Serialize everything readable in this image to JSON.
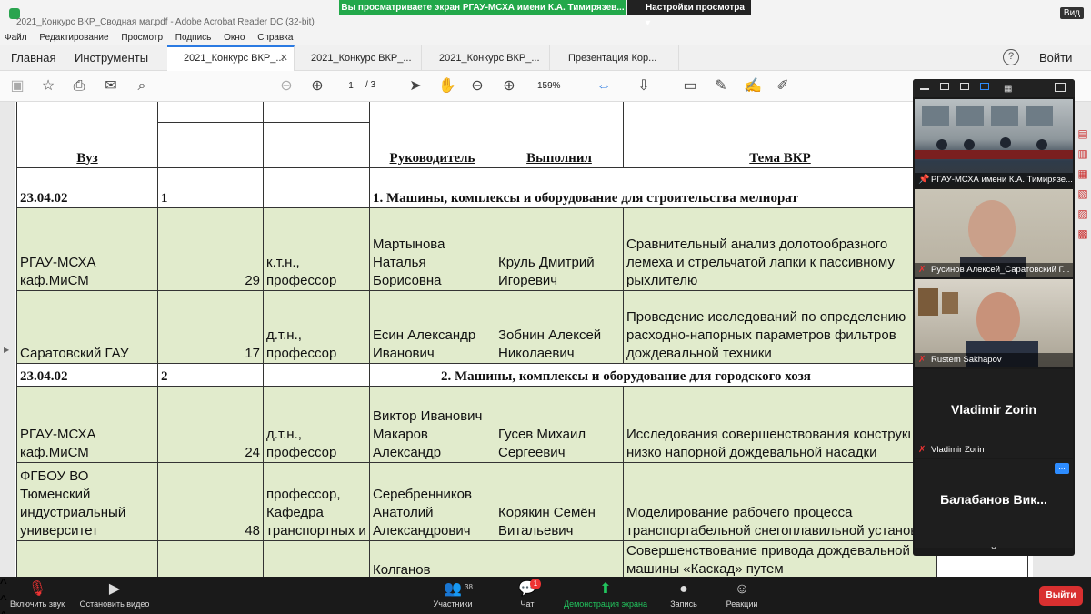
{
  "window": {
    "doc_title": "2021_Конкурс ВКР_Сводная маг.pdf - Adobe Acrobat Reader DC (32-bit)",
    "view_label": "Вид"
  },
  "share_banner": {
    "text": "Вы просматриваете экран РГАУ-МСХА имени К.А. Тимирязев...",
    "settings_label": "Настройки просмотра ▾"
  },
  "menubar": [
    "Файл",
    "Редактирование",
    "Просмотр",
    "Подпись",
    "Окно",
    "Справка"
  ],
  "tabs": {
    "home": "Главная",
    "tools": "Инструменты",
    "docs": [
      {
        "label": "2021_Конкурс ВКР_...",
        "active": true
      },
      {
        "label": "2021_Конкурс ВКР_...",
        "active": false
      },
      {
        "label": "2021_Конкурс ВКР_...",
        "active": false
      },
      {
        "label": "Презентация  Кор...",
        "active": false
      }
    ],
    "help": "?",
    "login": "Войти"
  },
  "toolbar": {
    "page_current": "1",
    "page_total": "/ 3",
    "zoom": "159%"
  },
  "table": {
    "headers": {
      "vuz": "Вуз",
      "leader": "Руководитель",
      "performer": "Выполнил",
      "topic": "Тема ВКР"
    },
    "sections": [
      {
        "code": "23.04.02",
        "num": "1",
        "title": "1. Машины, комплексы и оборудование для строительства мелиорат",
        "rows": [
          {
            "vuz": "РГАУ-МСХА каф.МиСМ",
            "score": "29",
            "degree": "к.т.н., профессор",
            "leader": "Мартынова Наталья Борисовна",
            "performer": "Круль Дмитрий Игоревич",
            "topic": "Сравнительный анализ долотообразного лемеха и стрельчатой лапки к пассивному рыхлителю"
          },
          {
            "vuz": "Саратовский ГАУ",
            "score": "17",
            "degree": "д.т.н., профессор",
            "leader": "Есин Александр Иванович",
            "performer": "Зобнин Алексей Николаевич",
            "topic": "Проведение исследований по определению расходно-напорных параметров фильтров дождевальной техники"
          }
        ]
      },
      {
        "code": "23.04.02",
        "num": "2",
        "title": "2. Машины, комплексы и оборудование для городского хозя",
        "rows": [
          {
            "vuz": "РГАУ-МСХА каф.МиСМ",
            "score": "24",
            "degree": "д.т.н., профессор",
            "leader": "Виктор Иванович Макаров Александр",
            "performer": "Гусев Михаил Сергеевич",
            "topic": "Исследования совершенствования конструкции  низко напорной дождевальной  насадки"
          },
          {
            "vuz": "ФГБОУ ВО Тюменский индустриальный университет",
            "score": "48",
            "degree": "профессор, Кафедра транспортных и",
            "leader": "Серебренников Анатолий Александрович",
            "performer": "Корякин Семён Витальевич",
            "topic": "Моделирование рабочего процесса транспортабельной снегоплавильной установки"
          },
          {
            "vuz": "",
            "score": "",
            "degree": "",
            "leader": "Колганов",
            "performer": "",
            "topic": "Совершенствование привода дождевальной машины «Каскад» путем"
          }
        ]
      }
    ]
  },
  "video_panel": {
    "tiles": [
      {
        "name": "РГАУ-МСХА имени К.А. Тимирязе...",
        "kind": "room"
      },
      {
        "name": "Русинов Алексей_Саратовский Г...",
        "kind": "person"
      },
      {
        "name": "Rustem Sakhapov",
        "kind": "person"
      },
      {
        "name": "Vladimir Zorin",
        "big": "Vladimir Zorin",
        "kind": "avatar"
      },
      {
        "name": "",
        "big": "Балабанов  Вик...",
        "kind": "avatar"
      }
    ],
    "more": "..."
  },
  "zoom_bar": {
    "mute": "Включить звук",
    "video": "Остановить видео",
    "participants": "Участники",
    "participants_count": "38",
    "chat": "Чат",
    "chat_badge": "1",
    "share": "Демонстрация экрана",
    "record": "Запись",
    "reactions": "Реакции",
    "exit": "Выйти"
  }
}
